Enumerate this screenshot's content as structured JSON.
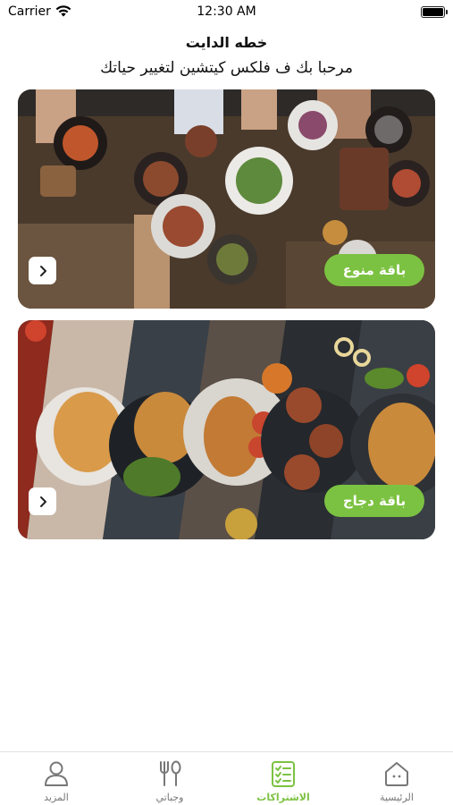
{
  "status_bar": {
    "carrier": "Carrier",
    "time": "12:30 AM"
  },
  "header": {
    "title": "خطه الدايت",
    "subtitle": "مرحبا بك ف فلكس كيتشين لتغيير حياتك"
  },
  "plans": [
    {
      "label": "باقة منوع"
    },
    {
      "label": "باقة دجاج"
    }
  ],
  "tab_bar": {
    "items": [
      {
        "label": "المزيد",
        "icon": "person-icon",
        "active": false
      },
      {
        "label": "وجباتي",
        "icon": "fork-spoon-icon",
        "active": false
      },
      {
        "label": "الاشتراكات",
        "icon": "clipboard-list-icon",
        "active": true
      },
      {
        "label": "الرئيسية",
        "icon": "house-icon",
        "active": false
      }
    ]
  },
  "colors": {
    "accent": "#7cc242",
    "inactive_tab": "#777777"
  }
}
